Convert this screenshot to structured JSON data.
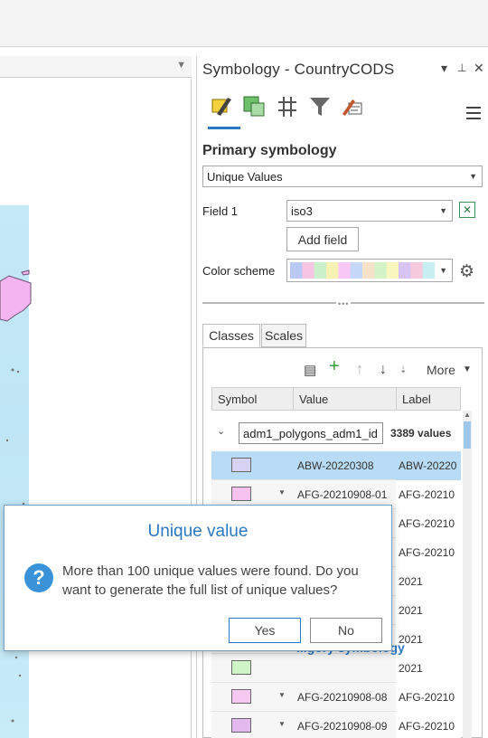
{
  "pane": {
    "title": "Symbology - CountryCODS",
    "controls": {
      "dropdown": "▾",
      "pin": "⊥",
      "close": "✕"
    }
  },
  "icon_tabs": [
    "primary-symbology-icon",
    "vary-symbology-icon",
    "symbol-layer-drawing-icon",
    "filter-icon",
    "label-class-icon"
  ],
  "primary_symbology": {
    "heading": "Primary symbology",
    "renderer": "Unique Values",
    "field1_label": "Field 1",
    "field1_value": "iso3",
    "add_field_label": "Add field",
    "color_scheme_label": "Color scheme",
    "color_scheme_swatches": [
      "#b9c8f5",
      "#f6c5e4",
      "#c9f0c8",
      "#f7f2b4",
      "#f9c7f6",
      "#c6d8f7",
      "#f6e2c8",
      "#d4f3c6",
      "#f9f6c0",
      "#d8c4f4",
      "#f7c9dc",
      "#c7eff2"
    ]
  },
  "tabs": [
    "Classes",
    "Scales"
  ],
  "toolbar": {
    "more_label": "More"
  },
  "table": {
    "headers": [
      "Symbol",
      "Value",
      "Label"
    ],
    "group": {
      "name": "adm1_polygons_adm1_id",
      "count": "3389 values"
    },
    "rows": [
      {
        "value": "ABW-20220308",
        "label": "ABW-20220",
        "color": "#d8d2f4",
        "selected": true,
        "caret": false
      },
      {
        "value": "AFG-20210908-01",
        "label": "AFG-20210",
        "color": "#f6c2f0",
        "selected": false,
        "caret": true
      },
      {
        "value": "",
        "label": "AFG-20210",
        "color": "",
        "selected": false,
        "caret": false
      },
      {
        "value": "",
        "label": "AFG-20210",
        "color": "",
        "selected": false,
        "caret": false
      },
      {
        "value": "",
        "label": "2021",
        "color": "",
        "selected": false,
        "caret": false
      },
      {
        "value": "",
        "label": "2021",
        "color": "",
        "selected": false,
        "caret": false
      },
      {
        "value": "",
        "label": "2021",
        "color": "",
        "selected": false,
        "caret": false
      },
      {
        "value": "",
        "label": "2021",
        "color": "#cff5c6",
        "selected": false,
        "caret": false
      },
      {
        "value": "AFG-20210908-08",
        "label": "AFG-20210",
        "color": "#f6c8f2",
        "selected": false,
        "caret": true
      },
      {
        "value": "AFG-20210908-09",
        "label": "AFG-20210",
        "color": "#e3b9f0",
        "selected": false,
        "caret": true
      }
    ]
  },
  "behind_dialog_text": "...gory symbology",
  "dialog": {
    "title": "Unique value",
    "message": "More than 100 unique values were found. Do you want to generate the full list of unique values?",
    "yes_label": "Yes",
    "no_label": "No"
  }
}
